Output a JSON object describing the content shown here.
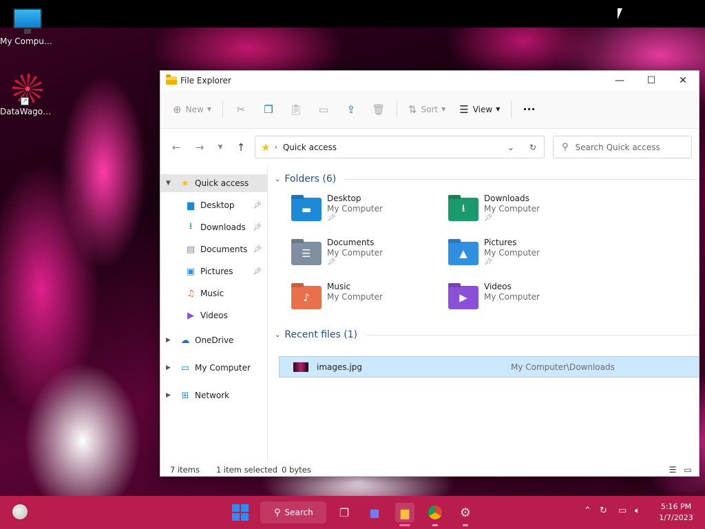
{
  "desktop": {
    "icons": [
      {
        "label": "My Computer",
        "icon": "monitor-icon"
      },
      {
        "label": "DataWagon...",
        "icon": "datawagon-icon"
      }
    ]
  },
  "window": {
    "title": "File Explorer",
    "controls": {
      "minimize": "—",
      "maximize": "☐",
      "close": "✕"
    }
  },
  "toolbar": {
    "new_label": "New",
    "sort_label": "Sort",
    "view_label": "View",
    "more_label": "···"
  },
  "address": {
    "location": "Quick access",
    "separator": "›"
  },
  "search": {
    "placeholder": "Search Quick access"
  },
  "sidebar": {
    "quick_access": "Quick access",
    "pinned": [
      {
        "label": "Desktop",
        "icon": "desktop-folder-icon",
        "pinned": true
      },
      {
        "label": "Downloads",
        "icon": "downloads-icon",
        "pinned": true
      },
      {
        "label": "Documents",
        "icon": "documents-icon",
        "pinned": true
      },
      {
        "label": "Pictures",
        "icon": "pictures-icon",
        "pinned": true
      },
      {
        "label": "Music",
        "icon": "music-icon",
        "pinned": false
      },
      {
        "label": "Videos",
        "icon": "videos-icon",
        "pinned": false
      }
    ],
    "roots": [
      {
        "label": "OneDrive",
        "icon": "onedrive-icon"
      },
      {
        "label": "My Computer",
        "icon": "computer-icon"
      },
      {
        "label": "Network",
        "icon": "network-icon"
      }
    ]
  },
  "main": {
    "folders_heading": "Folders (6)",
    "folders": [
      {
        "name": "Desktop",
        "location": "My Computer",
        "pinned": true,
        "color": "#1d8ad8"
      },
      {
        "name": "Downloads",
        "location": "My Computer",
        "pinned": true,
        "color": "#1b9a6c"
      },
      {
        "name": "Documents",
        "location": "My Computer",
        "pinned": true,
        "color": "#7f8ea3"
      },
      {
        "name": "Pictures",
        "location": "My Computer",
        "pinned": true,
        "color": "#2f8fe0"
      },
      {
        "name": "Music",
        "location": "My Computer",
        "pinned": false,
        "color": "#e8704a"
      },
      {
        "name": "Videos",
        "location": "My Computer",
        "pinned": false,
        "color": "#8b4fd8"
      }
    ],
    "recent_heading": "Recent files (1)",
    "recent": [
      {
        "name": "images.jpg",
        "path": "My Computer\\Downloads"
      }
    ]
  },
  "status": {
    "items": "7 items",
    "selected": "1 item selected",
    "size": "0 bytes"
  },
  "taskbar": {
    "search_label": "Search",
    "time": "5:16 PM",
    "date": "1/7/2023",
    "accent": "#b91d4e"
  }
}
